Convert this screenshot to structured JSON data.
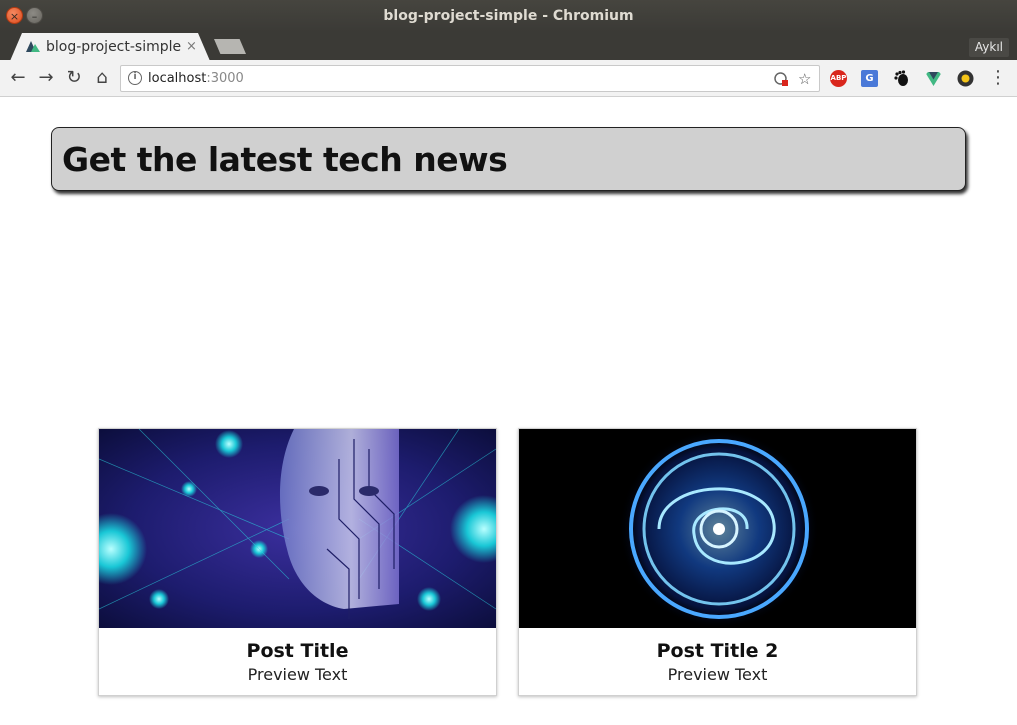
{
  "window": {
    "title": "blog-project-simple - Chromium",
    "close_glyph": "×",
    "min_glyph": "–"
  },
  "tab": {
    "label": "blog-project-simple",
    "close_glyph": "×",
    "favicon": "nuxt-logo-icon"
  },
  "profile_button": "Aykıl",
  "toolbar": {
    "back_glyph": "←",
    "forward_glyph": "→",
    "reload_glyph": "↻",
    "home_glyph": "⌂",
    "url_host": "localhost",
    "url_port": ":3000",
    "info_glyph": "i",
    "star_glyph": "☆",
    "menu_glyph": "⋮",
    "extensions": [
      {
        "name": "adblock-plus-icon",
        "label": "ABP",
        "color": "#d9261c"
      },
      {
        "name": "google-translate-icon",
        "label": "G",
        "color": "#4a79d8"
      },
      {
        "name": "gnome-icon",
        "label": "",
        "color": "#111111"
      },
      {
        "name": "vue-devtools-icon",
        "label": "",
        "color": "#41b883"
      },
      {
        "name": "color-picker-icon",
        "label": "",
        "color": "#333333"
      }
    ]
  },
  "page": {
    "hero_title": "Get the latest tech news",
    "posts": [
      {
        "title": "Post Title",
        "preview": "Preview Text",
        "image": "ai-face-circuit-image"
      },
      {
        "title": "Post Title 2",
        "preview": "Preview Text",
        "image": "blue-energy-ring-image"
      }
    ]
  },
  "colors": {
    "hero_bg": "#d0d0d0",
    "titlebar_bg": "#3b3a36"
  }
}
